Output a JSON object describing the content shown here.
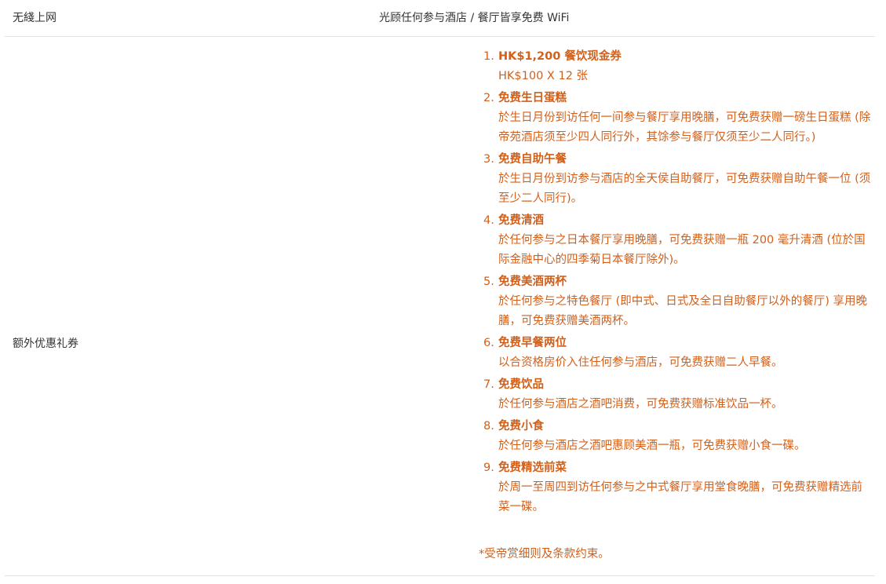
{
  "rows": {
    "wifi": {
      "label": "无綫上网",
      "value": "光顾任何参与酒店 / 餐厅皆享免费 WiFi"
    },
    "coupons": {
      "label": "额外优惠礼券",
      "items": [
        {
          "num": "1.",
          "title": "HK$1,200 餐饮现金券",
          "desc": "HK$100 X 12 张"
        },
        {
          "num": "2.",
          "title": "免费生日蛋糕",
          "desc": "於生日月份到访任何一间参与餐厅享用晚膳，可免费获赠一磅生日蛋糕 (除帝苑酒店须至少四人同行外，其馀参与餐厅仅须至少二人同行。)"
        },
        {
          "num": "3.",
          "title": "免费自助午餐",
          "desc": "於生日月份到访参与酒店的全天侯自助餐厅，可免费获赠自助午餐一位 (须至少二人同行)。"
        },
        {
          "num": "4.",
          "title": "免费清酒",
          "desc": "於任何参与之日本餐厅享用晚膳，可免费获赠一瓶 200 毫升清酒 (位於国际金融中心的四季菊日本餐厅除外)。"
        },
        {
          "num": "5.",
          "title": "免费美酒两杯",
          "desc": "於任何参与之特色餐厅 (即中式、日式及全日自助餐厅以外的餐厅) 享用晚膳，可免费获赠美酒两杯。"
        },
        {
          "num": "6.",
          "title": "免费早餐两位",
          "desc": "以合资格房价入住任何参与酒店，可免费获赠二人早餐。"
        },
        {
          "num": "7.",
          "title": "免费饮品",
          "desc": "於任何参与酒店之酒吧消费，可免费获赠标准饮品一杯。"
        },
        {
          "num": "8.",
          "title": "免费小食",
          "desc": "於任何参与酒店之酒吧惠顾美酒一瓶，可免费获赠小食一碟。"
        },
        {
          "num": "9.",
          "title": "免费精选前菜",
          "desc": "於周一至周四到访任何参与之中式餐厅享用堂食晚膳，可免费获赠精选前菜一碟。"
        }
      ],
      "footnote": "*受帝赏细则及条款约束。"
    }
  },
  "colors": {
    "accent": "#d2601a",
    "text": "#333333",
    "divider": "#e3e3e3"
  }
}
